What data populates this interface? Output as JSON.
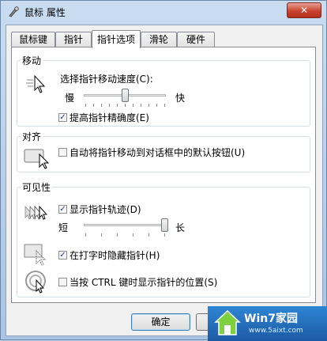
{
  "window": {
    "title": "鼠标 属性",
    "close_label": "✕"
  },
  "tabs": [
    {
      "label": "鼠标键",
      "active": false
    },
    {
      "label": "指针",
      "active": false
    },
    {
      "label": "指针选项",
      "active": true
    },
    {
      "label": "滑轮",
      "active": false
    },
    {
      "label": "硬件",
      "active": false
    }
  ],
  "motion": {
    "label": "移动",
    "speed_label": "选择指针移动速度(C):",
    "slow_label": "慢",
    "fast_label": "快",
    "speed_level": 0.5,
    "precision_label": "提高指针精确度(E)",
    "precision_checked": true
  },
  "snap": {
    "label": "对齐",
    "snap_label": "自动将指针移动到对话框中的默认按钮(U)",
    "snap_checked": false
  },
  "visibility": {
    "label": "可见性",
    "trails_label": "显示指针轨迹(D)",
    "trails_checked": true,
    "short_label": "短",
    "long_label": "长",
    "trail_level": 1.0,
    "hide_label": "在打字时隐藏指针(H)",
    "hide_checked": true,
    "ctrl_label": "当按 CTRL 键时显示指针的位置(S)",
    "ctrl_checked": false
  },
  "buttons": {
    "ok": "确定"
  },
  "watermark": {
    "title": "Win7家园",
    "url": "www.5aixt.com"
  }
}
